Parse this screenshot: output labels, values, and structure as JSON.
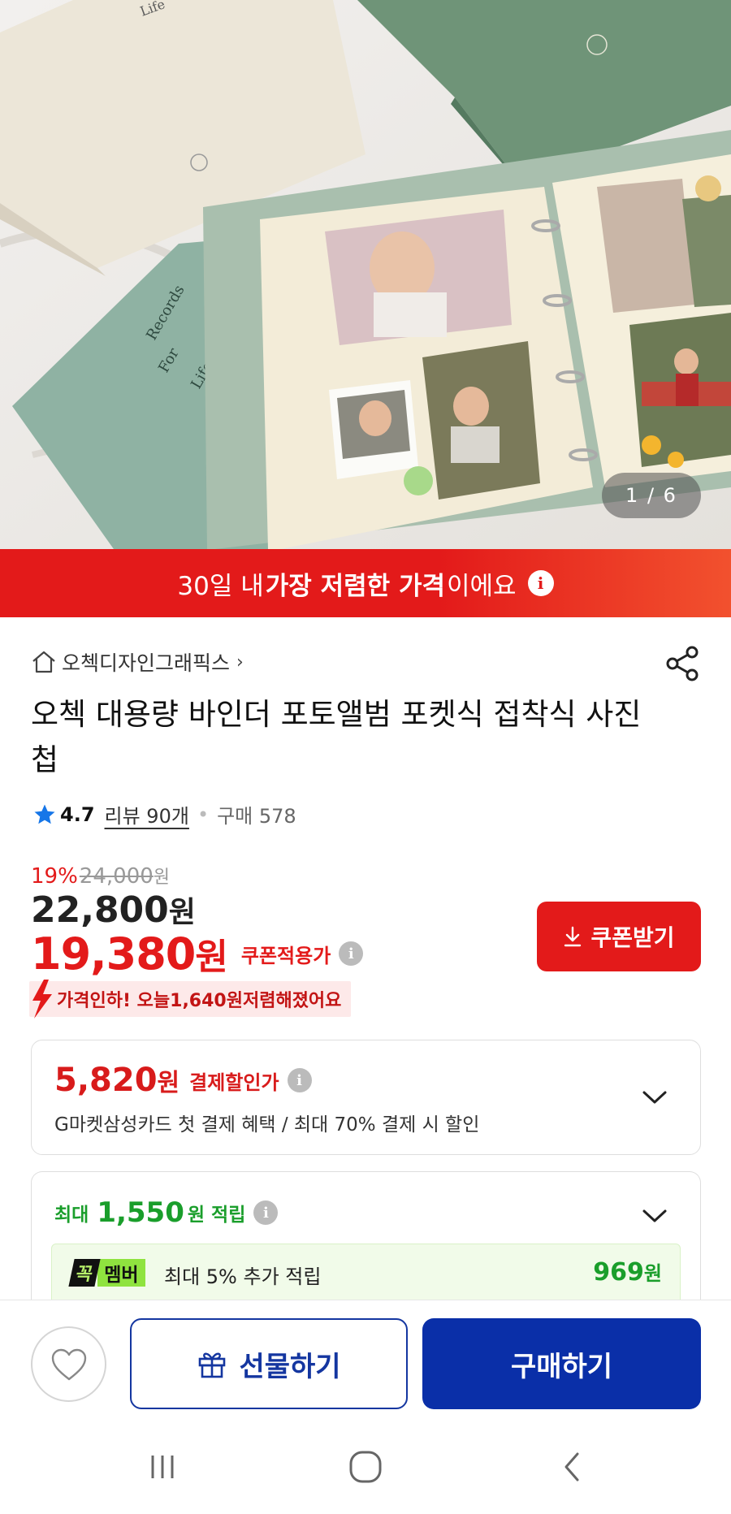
{
  "hero": {
    "counter": "1 / 6",
    "book_text_1": "Records",
    "book_text_2": "For",
    "book_text_3": "Life",
    "book_text_top": "Life"
  },
  "banner": {
    "part1": "30일 내 ",
    "part2": "가장 저렴한 가격",
    "part3": "이에요",
    "info": "i"
  },
  "store": {
    "name": "오첵디자인그래픽스",
    "chevron": "›"
  },
  "product": {
    "title": "오첵 대용량 바인더 포토앨범 포켓식 접착식 사진첩"
  },
  "rating": {
    "score": "4.7",
    "reviews": "리뷰 90개",
    "purchases": "구매 578"
  },
  "price": {
    "discount_pct": "19%",
    "original": "24,000",
    "won": "원",
    "sale": "22,800",
    "sale_won": "원",
    "coupon_price": "19,380",
    "coupon_won": "원",
    "coupon_label": "쿠폰적용가",
    "drop_text_1": "가격인하! 오늘 ",
    "drop_amount": "1,640원",
    "drop_text_2": " 저렴해졌어요"
  },
  "coupon_button": {
    "label": "쿠폰받기"
  },
  "payment_card": {
    "amount": "5,820",
    "won": "원",
    "label": "결제할인가",
    "desc": "G마켓삼성카드 첫 결제 혜택 / 최대 70% 결제 시 할인"
  },
  "points_card": {
    "prefix": "최대",
    "amount": "1,550",
    "won": "원",
    "label": "적립",
    "member_badge_k": "꼭",
    "member_badge_m": "멤버",
    "member_text": "최대 5% 추가 적립",
    "member_amount": "969",
    "member_won": "원"
  },
  "bottom_bar": {
    "gift_label": "선물하기",
    "buy_label": "구매하기"
  },
  "colors": {
    "accent_red": "#e31a1a",
    "accent_blue": "#0a2fa8",
    "points_green": "#1a9e2b"
  }
}
